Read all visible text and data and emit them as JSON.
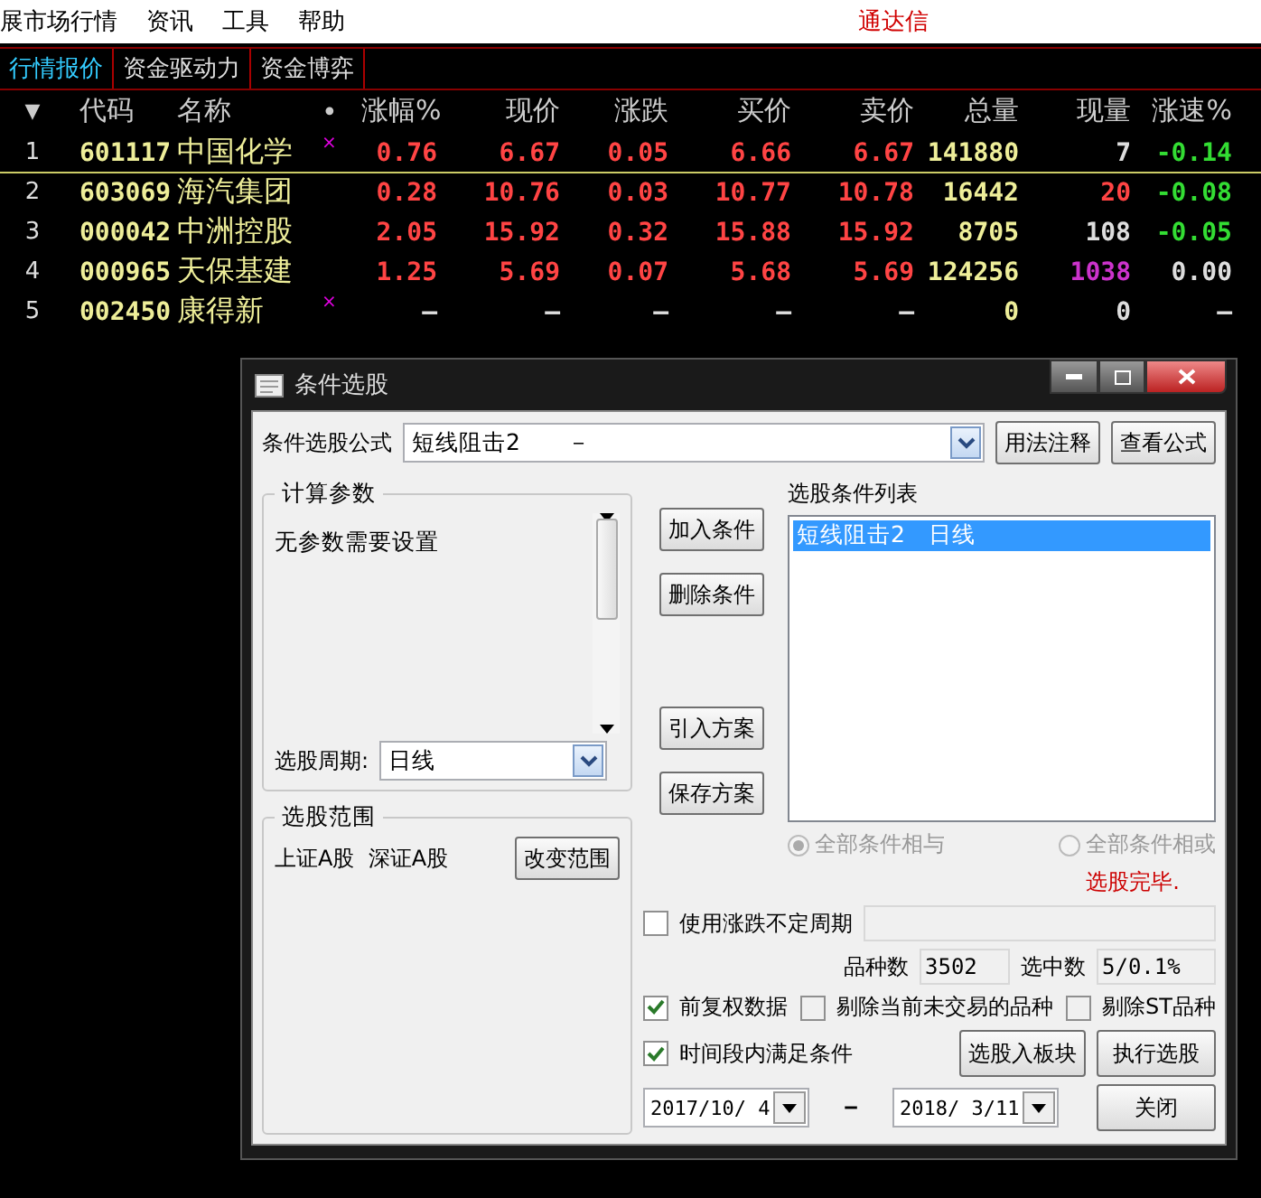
{
  "menu": [
    {
      "label": "展市场行情"
    },
    {
      "label": "资讯"
    },
    {
      "label": "工具"
    },
    {
      "label": "帮助"
    }
  ],
  "brand": "通达信",
  "tabs": [
    {
      "label": "行情报价",
      "selected": true
    },
    {
      "label": "资金驱动力",
      "selected": false
    },
    {
      "label": "资金博弈",
      "selected": false
    }
  ],
  "table": {
    "sort_header": "▼",
    "code_header": "代码",
    "name_header": "名称",
    "mark_header": "•",
    "columns": [
      "涨幅%",
      "现价",
      "涨跌",
      "买价",
      "卖价",
      "总量",
      "现量",
      "涨速%"
    ],
    "rows": [
      {
        "index": "1",
        "code": "601117",
        "name": "中国化学",
        "mark": "×",
        "selected": true,
        "cells": [
          {
            "text": "0.76",
            "color": "#ff4444"
          },
          {
            "text": "6.67",
            "color": "#ff4444"
          },
          {
            "text": "0.05",
            "color": "#ff4444"
          },
          {
            "text": "6.66",
            "color": "#ff4444"
          },
          {
            "text": "6.67",
            "color": "#ff4444"
          },
          {
            "text": "141880",
            "color": "#eeee99"
          },
          {
            "text": "7",
            "color": "#dddddd"
          },
          {
            "text": "-0.14",
            "color": "#33dd33"
          }
        ]
      },
      {
        "index": "2",
        "code": "603069",
        "name": "海汽集团",
        "selected": false,
        "cells": [
          {
            "text": "0.28",
            "color": "#ff4444"
          },
          {
            "text": "10.76",
            "color": "#ff4444"
          },
          {
            "text": "0.03",
            "color": "#ff4444"
          },
          {
            "text": "10.77",
            "color": "#ff4444"
          },
          {
            "text": "10.78",
            "color": "#ff4444"
          },
          {
            "text": "16442",
            "color": "#eeee99"
          },
          {
            "text": "20",
            "color": "#ff4444"
          },
          {
            "text": "-0.08",
            "color": "#33dd33"
          }
        ]
      },
      {
        "index": "3",
        "code": "000042",
        "name": "中洲控股",
        "selected": false,
        "cells": [
          {
            "text": "2.05",
            "color": "#ff4444"
          },
          {
            "text": "15.92",
            "color": "#ff4444"
          },
          {
            "text": "0.32",
            "color": "#ff4444"
          },
          {
            "text": "15.88",
            "color": "#ff4444"
          },
          {
            "text": "15.92",
            "color": "#ff4444"
          },
          {
            "text": "8705",
            "color": "#eeee99"
          },
          {
            "text": "108",
            "color": "#dddddd"
          },
          {
            "text": "-0.05",
            "color": "#33dd33"
          }
        ]
      },
      {
        "index": "4",
        "code": "000965",
        "name": "天保基建",
        "selected": false,
        "cells": [
          {
            "text": "1.25",
            "color": "#ff4444"
          },
          {
            "text": "5.69",
            "color": "#ff4444"
          },
          {
            "text": "0.07",
            "color": "#ff4444"
          },
          {
            "text": "5.68",
            "color": "#ff4444"
          },
          {
            "text": "5.69",
            "color": "#ff4444"
          },
          {
            "text": "124256",
            "color": "#eeee99"
          },
          {
            "text": "1038",
            "color": "#cc33cc"
          },
          {
            "text": "0.00",
            "color": "#dddddd"
          }
        ]
      },
      {
        "index": "5",
        "code": "002450",
        "name": "康得新",
        "mark": "×",
        "selected": false,
        "cells": [
          {
            "text": "–",
            "color": "#dddddd"
          },
          {
            "text": "–",
            "color": "#dddddd"
          },
          {
            "text": "–",
            "color": "#dddddd"
          },
          {
            "text": "–",
            "color": "#dddddd"
          },
          {
            "text": "–",
            "color": "#dddddd"
          },
          {
            "text": "0",
            "color": "#eeee99"
          },
          {
            "text": "0",
            "color": "#dddddd"
          },
          {
            "text": "–",
            "color": "#dddddd"
          }
        ]
      }
    ]
  },
  "dialog": {
    "title": "条件选股",
    "formula": {
      "label": "条件选股公式",
      "value": "短线阻击2　　－"
    },
    "top_buttons": [
      "用法注释",
      "查看公式"
    ],
    "params": {
      "title": "计算参数",
      "message": "无参数需要设置",
      "period_label": "选股周期:",
      "period_value": "日线"
    },
    "scope": {
      "title": "选股范围",
      "text": "上证A股  深证A股",
      "button": "改变范围"
    },
    "actions": [
      "加入条件",
      "删除条件",
      "引入方案",
      "保存方案"
    ],
    "conditions": {
      "label": "选股条件列表",
      "items": [
        {
          "text": "短线阻击2　日线",
          "selected": true
        }
      ]
    },
    "logic_disabled": true,
    "logic": [
      {
        "label": "全部条件相与",
        "selected": true
      },
      {
        "label": "全部条件相或",
        "selected": false
      }
    ],
    "status": "选股完毕.",
    "variable_period": {
      "label": "使用涨跌不定周期",
      "checked": false
    },
    "count": {
      "label": "品种数",
      "value": "3502"
    },
    "picked": {
      "label": "选中数",
      "value": "5/0.1%"
    },
    "options": [
      {
        "label": "前复权数据",
        "checked": true
      },
      {
        "label": "剔除当前未交易的品种",
        "checked": false
      },
      {
        "label": "剔除ST品种",
        "checked": false
      }
    ],
    "period_check": {
      "label": "时间段内满足条件",
      "checked": true
    },
    "to_block": "选股入板块",
    "run": "执行选股",
    "close": "关闭",
    "date_from": "2017/10/ 4",
    "date_sep": "－",
    "date_to": "2018/ 3/11"
  }
}
